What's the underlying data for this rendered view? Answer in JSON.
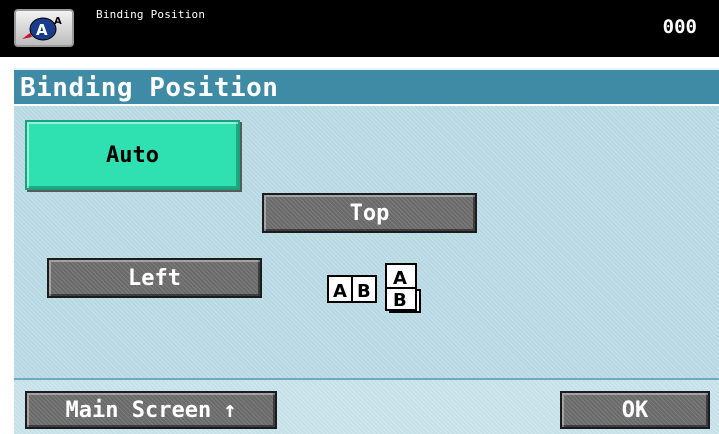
{
  "topbar": {
    "title": "Binding Position",
    "counter": "000",
    "mode_icon_name": "copy-mode-icon",
    "mode_icon_text": "A"
  },
  "header": {
    "title": "Binding Position"
  },
  "options": {
    "auto_label": "Auto",
    "top_label": "Top",
    "left_label": "Left",
    "selected": "Auto"
  },
  "illustration": {
    "icon": "binding-position-icon",
    "left_bound_letters": [
      "A",
      "B"
    ],
    "top_bound_letters": [
      "A",
      "B"
    ]
  },
  "footer": {
    "main_screen_label": "Main Screen",
    "main_screen_arrow": "↑",
    "ok_label": "OK"
  },
  "colors": {
    "topbar": "#000000",
    "header": "#3f8aa4",
    "panel": "#b6d8e3",
    "selected_button": "#2fe0b0",
    "button": "#6a6a6a"
  }
}
